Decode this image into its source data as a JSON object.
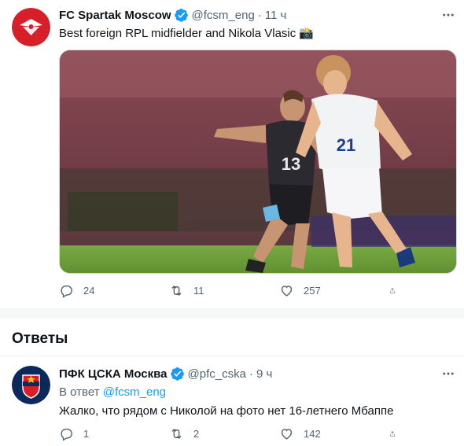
{
  "tweet": {
    "name": "FC Spartak Moscow",
    "handle": "@fcsm_eng",
    "separator": "·",
    "time": "11 ч",
    "text": "Best foreign RPL midfielder and Nikola Vlasic 📸",
    "media": {
      "left_player_number": "13",
      "right_player_number": "21"
    },
    "actions": {
      "replies": "24",
      "retweets": "11",
      "likes": "257"
    }
  },
  "replies_header": "Ответы",
  "reply": {
    "name": "ПФК ЦСКА Москва",
    "handle": "@pfc_cska",
    "separator": "·",
    "time": "9 ч",
    "reply_prefix": "В ответ",
    "reply_to": "@fcsm_eng",
    "text": "Жалко, что рядом с Николой на фото нет 16-летнего Мбаппе",
    "actions": {
      "replies": "1",
      "retweets": "2",
      "likes": "142"
    }
  },
  "colors": {
    "accent": "#1d9bf0",
    "spartak_red": "#d71f2b",
    "cska_navy": "#0b2a5b",
    "pitch_green": "#6b9a3a"
  },
  "icons": {
    "verified": "verified-badge-icon",
    "more": "more-icon",
    "reply": "reply-icon",
    "retweet": "retweet-icon",
    "like": "heart-icon",
    "share": "share-icon"
  }
}
